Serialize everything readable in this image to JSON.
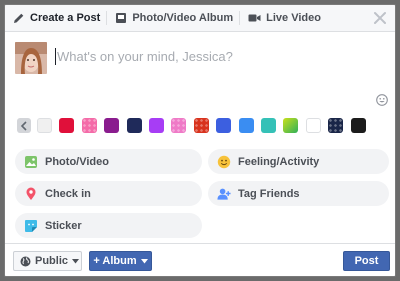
{
  "tabs": [
    {
      "label": "Create a Post",
      "icon": "pencil-icon"
    },
    {
      "label": "Photo/Video Album",
      "icon": "album-icon"
    },
    {
      "label": "Live Video",
      "icon": "video-camera-icon"
    }
  ],
  "composer": {
    "placeholder": "What's on your mind, Jessica?",
    "value": ""
  },
  "background_swatches": [
    {
      "name": "plain-white",
      "color": "#f0f0f0"
    },
    {
      "name": "crimson",
      "color": "#e0103a"
    },
    {
      "name": "pink-pattern",
      "color": "#f46ba8"
    },
    {
      "name": "purple-magenta",
      "color": "#8a1c8e"
    },
    {
      "name": "navy",
      "color": "#1f2a5a"
    },
    {
      "name": "violet",
      "color": "#a73df5"
    },
    {
      "name": "pink-pattern-2",
      "color": "#ef7ac7"
    },
    {
      "name": "red-orange-pattern",
      "color": "#d8331e"
    },
    {
      "name": "royal-blue",
      "color": "#3c5fe0"
    },
    {
      "name": "sky-blue",
      "color": "#3a8df2"
    },
    {
      "name": "teal",
      "color": "#35c1b7"
    },
    {
      "name": "lime-gradient",
      "color": "#7ccf16"
    },
    {
      "name": "white",
      "color": "#ffffff"
    },
    {
      "name": "dark-navy-pattern",
      "color": "#1a2648"
    },
    {
      "name": "black",
      "color": "#1c1c1c"
    }
  ],
  "options": [
    {
      "label": "Photo/Video",
      "icon": "photo-icon"
    },
    {
      "label": "Feeling/Activity",
      "icon": "smiley-icon"
    },
    {
      "label": "Check in",
      "icon": "location-pin-icon"
    },
    {
      "label": "Tag Friends",
      "icon": "tag-friends-icon"
    },
    {
      "label": "Sticker",
      "icon": "sticker-icon"
    }
  ],
  "footer": {
    "audience_label": "Public",
    "album_label": "+ Album",
    "post_label": "Post"
  },
  "colors": {
    "brand_blue": "#4267b2",
    "option_bg": "#f2f3f5"
  }
}
